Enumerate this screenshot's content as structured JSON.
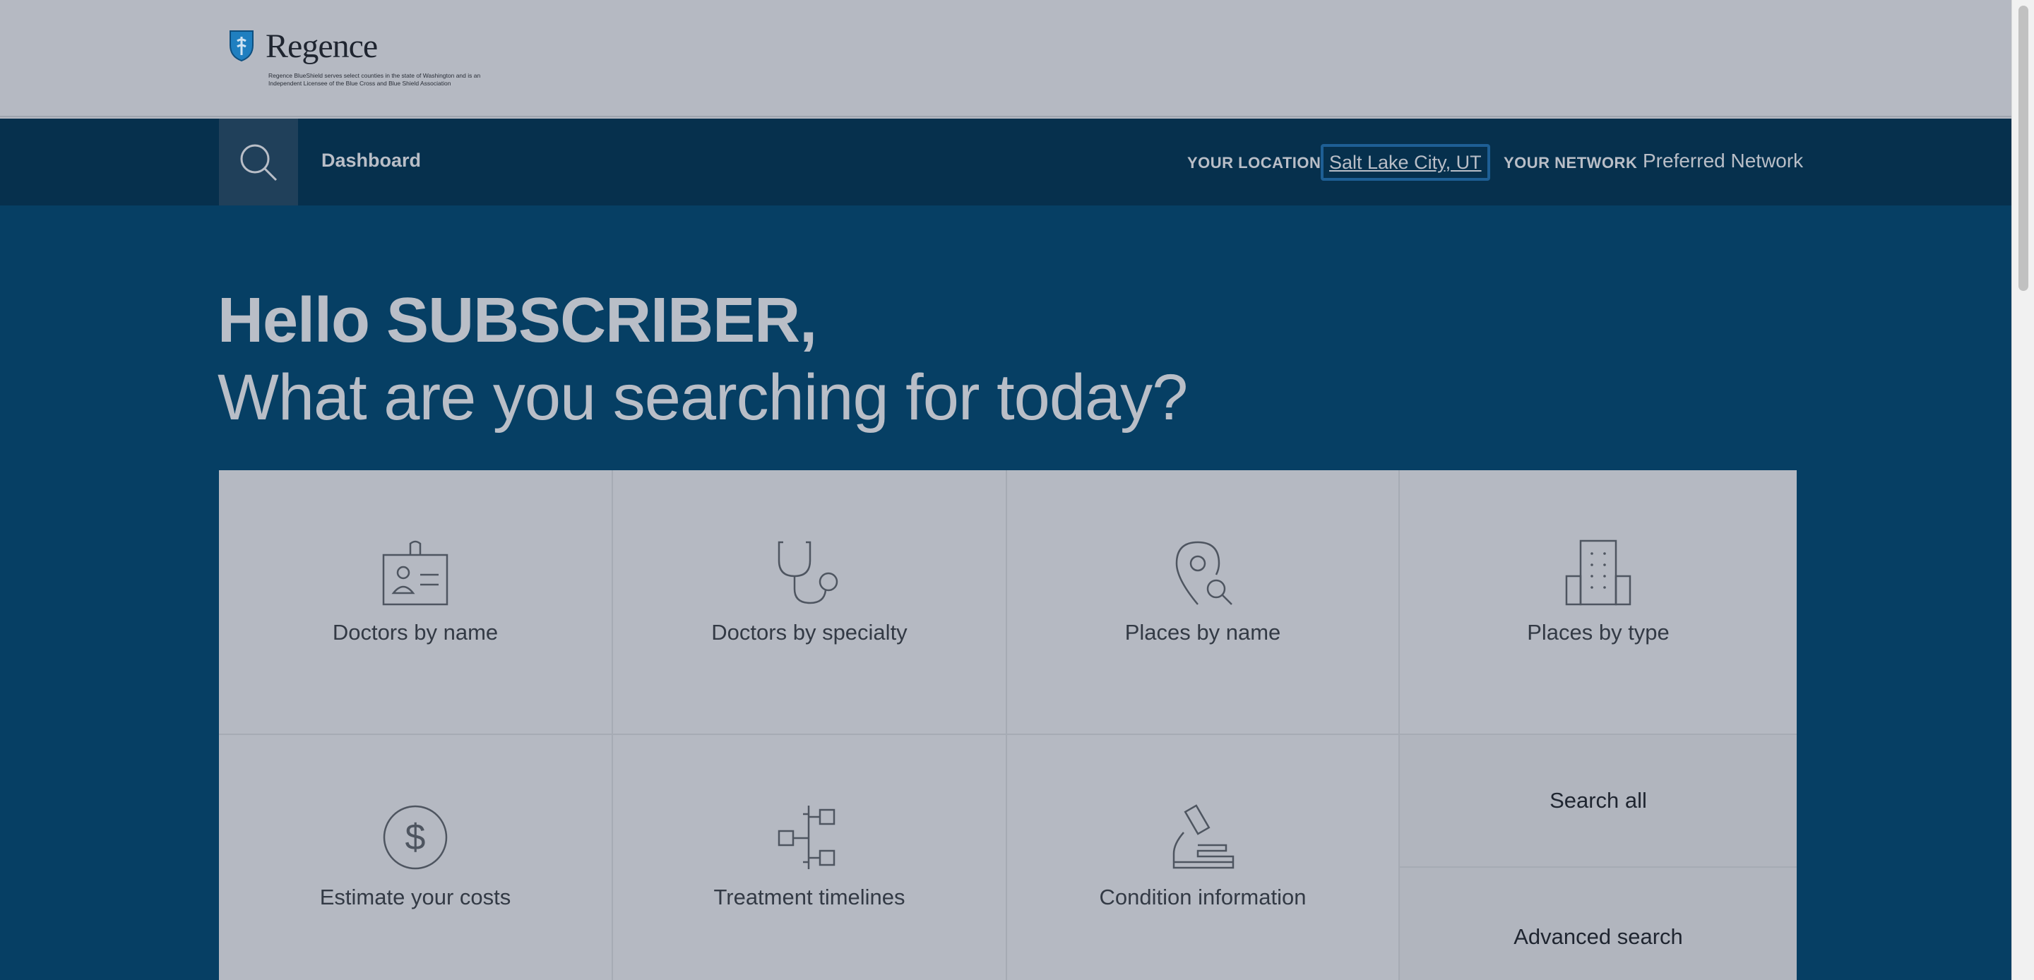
{
  "header": {
    "logo_text": "Regence",
    "logo_note": "Regence BlueShield serves select counties in the state of Washington and is an Independent Licensee of the Blue Cross and Blue Shield Association"
  },
  "nav": {
    "dashboard_label": "Dashboard",
    "location_label": "YOUR LOCATION",
    "location_value": "Salt Lake City, UT",
    "network_label": "YOUR NETWORK",
    "network_value": "Preferred Network"
  },
  "hero": {
    "greeting": "Hello SUBSCRIBER,",
    "question": "What are you searching for today?"
  },
  "tiles": [
    {
      "label": "Doctors by name",
      "icon": "id-badge-icon"
    },
    {
      "label": "Doctors by specialty",
      "icon": "stethoscope-icon"
    },
    {
      "label": "Places by name",
      "icon": "map-pin-search-icon"
    },
    {
      "label": "Places by type",
      "icon": "building-icon"
    },
    {
      "label": "Estimate your costs",
      "icon": "dollar-icon"
    },
    {
      "label": "Treatment timelines",
      "icon": "timeline-icon"
    },
    {
      "label": "Condition information",
      "icon": "microscope-icon"
    }
  ],
  "side_actions": {
    "search_all": "Search all",
    "advanced_search": "Advanced search"
  },
  "colors": {
    "header_bg": "#b5b9c2",
    "nav_bg": "#06304d",
    "hero_bg": "#063f64",
    "tile_bg": "#b5b9c2",
    "focus_outline": "#1e5f95"
  }
}
